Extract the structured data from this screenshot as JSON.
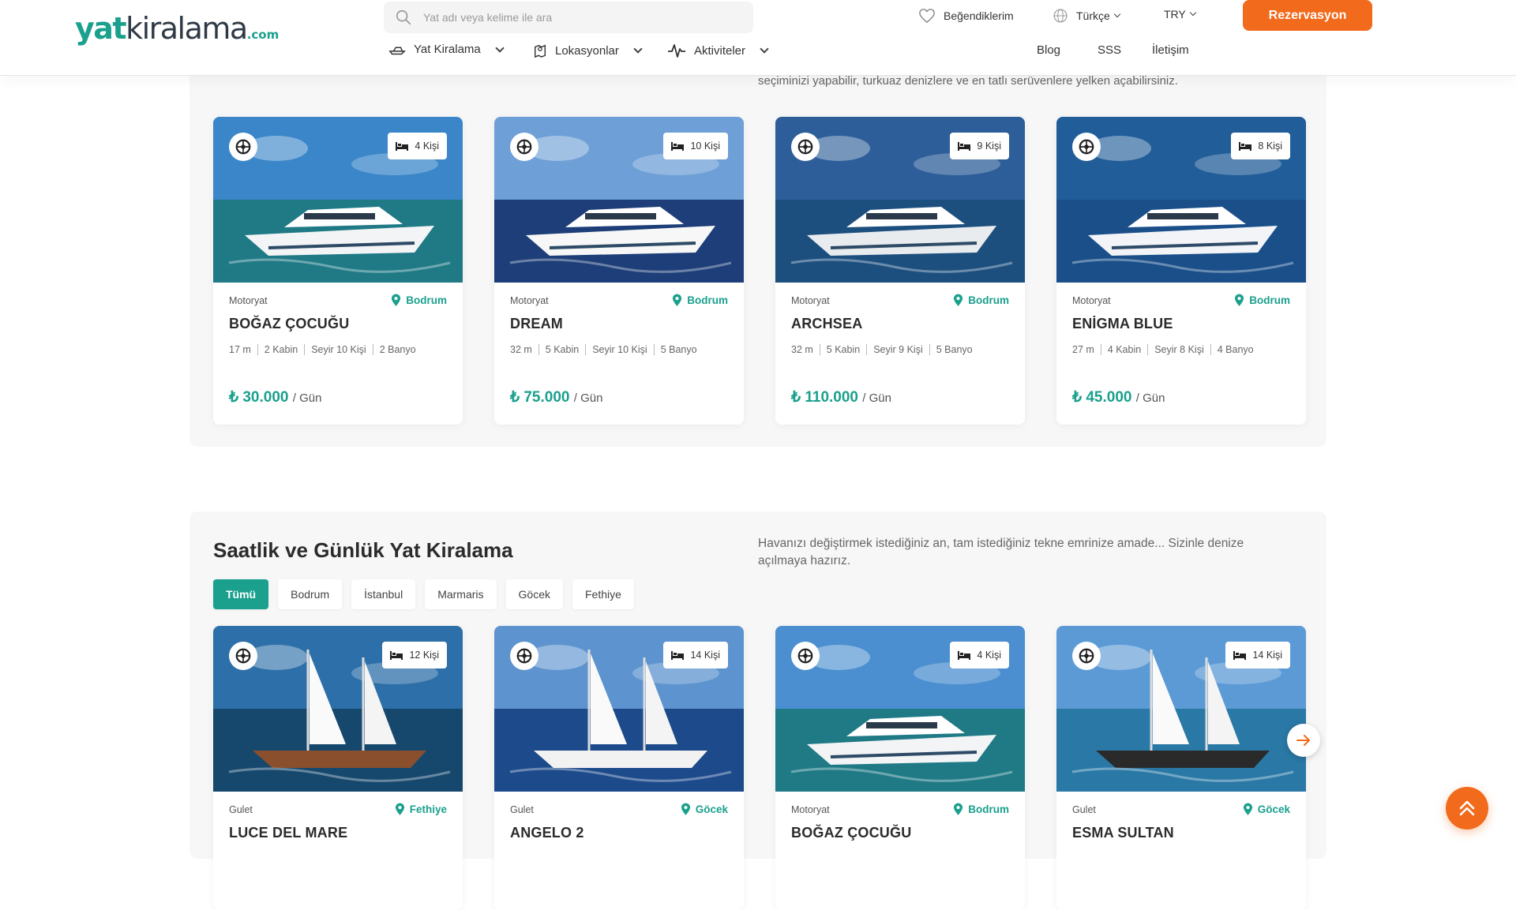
{
  "header": {
    "logo": {
      "part1": "yat",
      "part2": "kiralama",
      "part3": ".com"
    },
    "search_placeholder": "Yat adı veya kelime ile ara",
    "favorites": "Beğendiklerim",
    "language": "Türkçe",
    "currency": "TRY",
    "reserve_button": "Rezervasyon",
    "nav": {
      "yacht_rental": "Yat Kiralama",
      "locations": "Lokasyonlar",
      "activities": "Aktiviteler"
    },
    "links": {
      "blog": "Blog",
      "faq": "SSS",
      "contact": "İletişim"
    }
  },
  "section1": {
    "description": "seçiminizi yapabilir, turkuaz denizlere ve en tatlı serüvenlere yelken açabilirsiniz.",
    "cards": [
      {
        "capacity": "4 Kişi",
        "type": "Motoryat",
        "location": "Bodrum",
        "name": "BOĞAZ ÇOCUĞU",
        "specs": [
          "17 m",
          "2 Kabin",
          "Seyir 10 Kişi",
          "2 Banyo"
        ],
        "price": "₺ 30.000",
        "unit": "/ Gün",
        "sky": "#3a86c8",
        "sea": "#1f7a86",
        "hull": "#f2f4f6"
      },
      {
        "capacity": "10 Kişi",
        "type": "Motoryat",
        "location": "Bodrum",
        "name": "DREAM",
        "specs": [
          "32 m",
          "5 Kabin",
          "Seyir 10 Kişi",
          "5 Banyo"
        ],
        "price": "₺ 75.000",
        "unit": "/ Gün",
        "sky": "#6e9fd6",
        "sea": "#1d3e78",
        "hull": "#f7f7f7"
      },
      {
        "capacity": "9 Kişi",
        "type": "Motoryat",
        "location": "Bodrum",
        "name": "ARCHSEA",
        "specs": [
          "32 m",
          "5 Kabin",
          "Seyir 9 Kişi",
          "5 Banyo"
        ],
        "price": "₺ 110.000",
        "unit": "/ Gün",
        "sky": "#2d5e99",
        "sea": "#1d4f7e",
        "hull": "#e9ecef"
      },
      {
        "capacity": "8 Kişi",
        "type": "Motoryat",
        "location": "Bodrum",
        "name": "ENİGMA BLUE",
        "specs": [
          "27 m",
          "4 Kabin",
          "Seyir 8 Kişi",
          "4 Banyo"
        ],
        "price": "₺ 45.000",
        "unit": "/ Gün",
        "sky": "#215d98",
        "sea": "#1a4f8a",
        "hull": "#f2f4f7"
      }
    ]
  },
  "section2": {
    "title": "Saatlik ve Günlük Yat Kiralama",
    "description": "Havanızı değiştirmek istediğiniz an, tam istediğiniz tekne emrinize amade... Sizinle denize açılmaya hazırız.",
    "filters": [
      "Tümü",
      "Bodrum",
      "İstanbul",
      "Marmaris",
      "Göcek",
      "Fethiye"
    ],
    "cards": [
      {
        "capacity": "12 Kişi",
        "type": "Gulet",
        "location": "Fethiye",
        "name": "LUCE DEL MARE",
        "sky": "#2d6fa8",
        "sea": "#16486e",
        "hull": "#8a4f2c"
      },
      {
        "capacity": "14 Kişi",
        "type": "Gulet",
        "location": "Göcek",
        "name": "ANGELO 2",
        "sky": "#5d93cf",
        "sea": "#1d4a8a",
        "hull": "#f2f2f2"
      },
      {
        "capacity": "4 Kişi",
        "type": "Motoryat",
        "location": "Bodrum",
        "name": "BOĞAZ ÇOCUĞU",
        "sky": "#4b8fd0",
        "sea": "#1f7a86",
        "hull": "#f2f4f6"
      },
      {
        "capacity": "14 Kişi",
        "type": "Gulet",
        "location": "Göcek",
        "name": "ESMA SULTAN",
        "sky": "#5c9ad6",
        "sea": "#2a78a6",
        "hull": "#2a2a2a"
      }
    ]
  }
}
